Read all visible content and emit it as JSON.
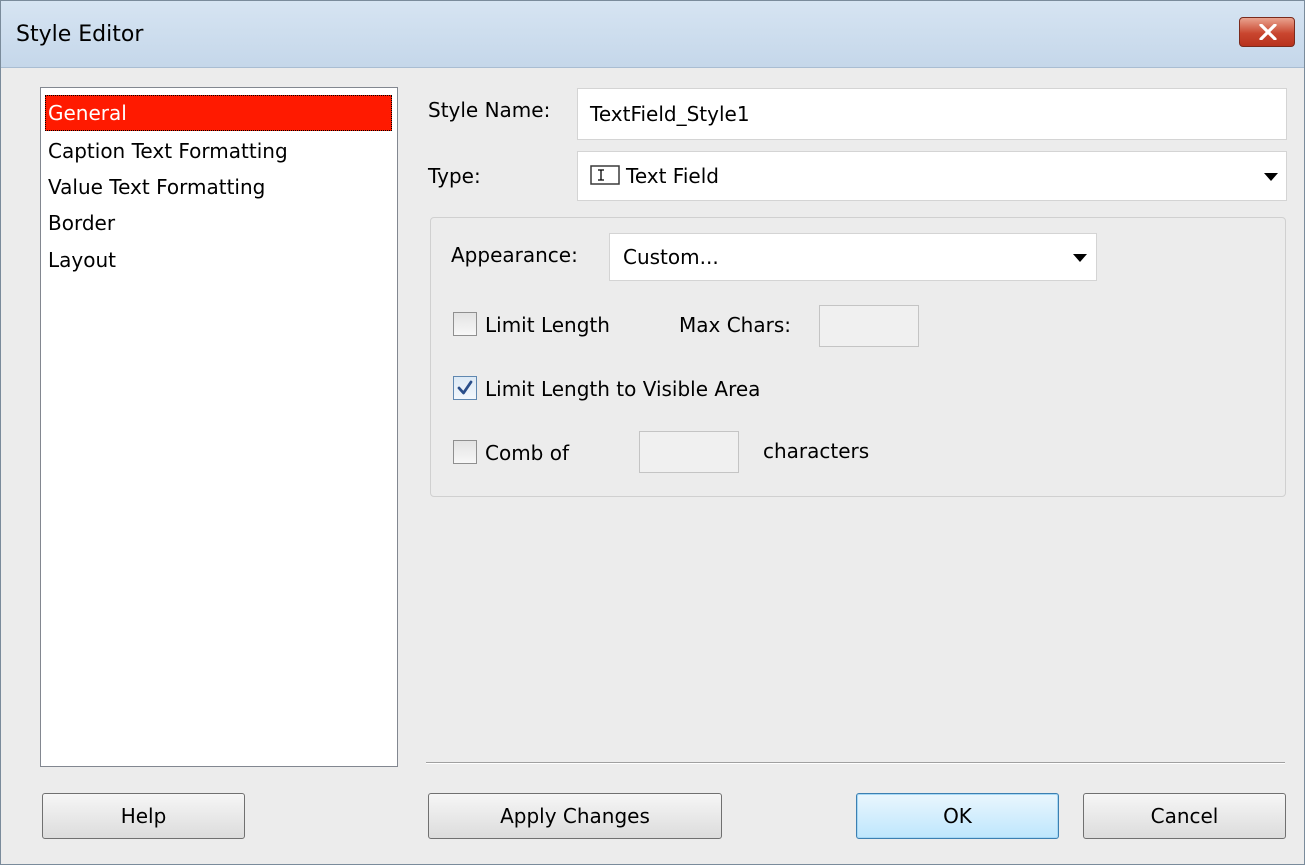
{
  "window": {
    "title": "Style Editor"
  },
  "sidebar": {
    "items": [
      {
        "label": "General",
        "selected": true
      },
      {
        "label": "Caption Text Formatting",
        "selected": false
      },
      {
        "label": "Value Text Formatting",
        "selected": false
      },
      {
        "label": "Border",
        "selected": false
      },
      {
        "label": "Layout",
        "selected": false
      }
    ]
  },
  "general": {
    "style_name_label": "Style Name:",
    "style_name_value": "TextField_Style1",
    "type_label": "Type:",
    "type_value": "Text Field",
    "type_icon": "text-field-icon",
    "appearance_label": "Appearance:",
    "appearance_value": "Custom...",
    "limit_length": {
      "label": "Limit Length",
      "checked": false
    },
    "max_chars_label": "Max Chars:",
    "max_chars_value": "",
    "limit_visible": {
      "label": "Limit Length to Visible Area",
      "checked": true
    },
    "comb_of": {
      "label": "Comb of",
      "checked": false
    },
    "comb_value": "",
    "characters_label": "characters"
  },
  "buttons": {
    "help": "Help",
    "apply": "Apply Changes",
    "ok": "OK",
    "cancel": "Cancel"
  },
  "colors": {
    "selection": "#ff1a00",
    "title_bar": "#c5d7ea",
    "close_button": "#c9462f",
    "dialog_bg": "#ececec"
  }
}
